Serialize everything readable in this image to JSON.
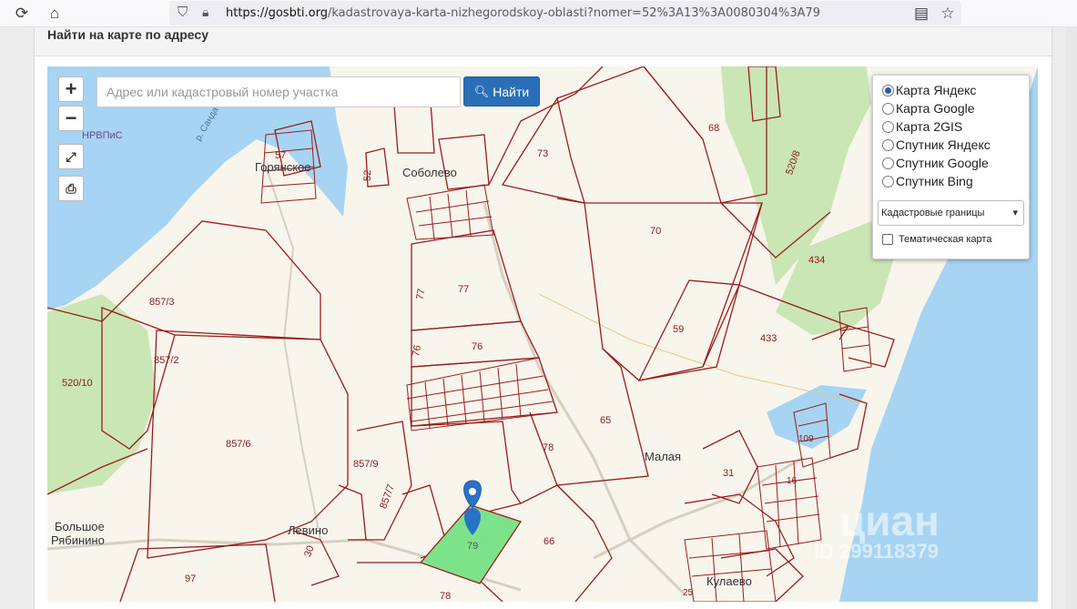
{
  "browser": {
    "url_host": "https://gosbti.org",
    "url_path": "/kadastrovaya-karta-nizhegorodskoy-oblasti?nomer=52%3A13%3A0080304%3A79"
  },
  "panel": {
    "title": "Найти на карте по адресу"
  },
  "map": {
    "zoom_in": "+",
    "zoom_out": "−",
    "search_placeholder": "Адрес или кадастровый номер участка",
    "find_label": "Найти",
    "layers": [
      {
        "label": "Карта Яндекс",
        "selected": true
      },
      {
        "label": "Карта Google",
        "selected": false
      },
      {
        "label": "Карта 2GIS",
        "selected": false
      },
      {
        "label": "Спутник Яндекс",
        "selected": false
      },
      {
        "label": "Спутник Google",
        "selected": false
      },
      {
        "label": "Спутник Bing",
        "selected": false
      }
    ],
    "overlay_select": "Кадастровые границы",
    "thematic_label": "Тематическая карта",
    "places": {
      "nrvpis": "НРВПиС",
      "goryanskoe": "Горянское",
      "sobolevo": "Соболево",
      "bolshoe_ryabinino_1": "Большое",
      "bolshoe_ryabinino_2": "Рябинино",
      "levino": "Левино",
      "malaya": "Малая",
      "kulaevo": "Кулаево",
      "river": "р. Санда"
    },
    "parcels": {
      "p73": "73",
      "p68": "68",
      "p70": "70",
      "p434": "434",
      "p520_8": "520/8",
      "p52": "52",
      "p57": "57",
      "p77a": "77",
      "p77b": "77",
      "p59": "59",
      "p433": "433",
      "p857_3": "857/3",
      "p857_2": "857/2",
      "p520_10": "520/10",
      "p76a": "76",
      "p76b": "76",
      "p65": "65",
      "p857_6": "857/6",
      "p857_9": "857/9",
      "p857_7": "857/7",
      "p78a": "78",
      "p109": "109",
      "p31": "31",
      "p16": "16",
      "p79": "79",
      "p66": "66",
      "p30": "30",
      "p97": "97",
      "p78b": "78",
      "p25": "25"
    },
    "watermark_brand": "циан",
    "watermark_id": "ID 299118379"
  },
  "colors": {
    "water": "#a7d4f2",
    "forest": "#cbe6b5",
    "land": "#f8f5ec",
    "boundary": "#9b1c1c",
    "selected_parcel": "#7de38a",
    "marker": "#2a72c8",
    "button_primary": "#2a6fb6"
  }
}
